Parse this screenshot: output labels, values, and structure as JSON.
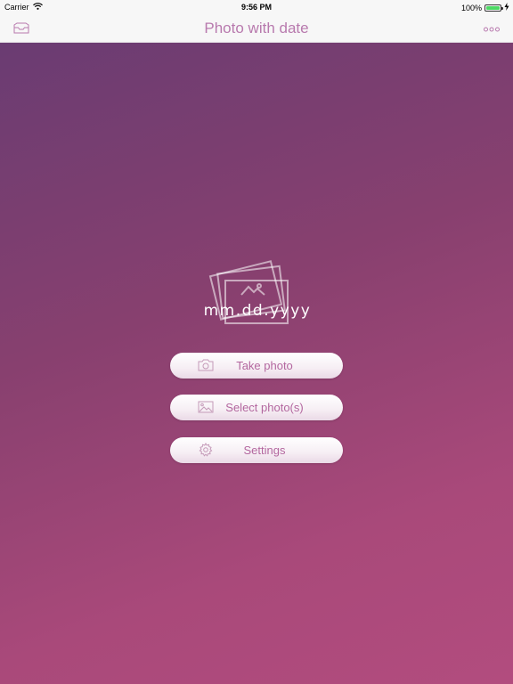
{
  "status_bar": {
    "carrier": "Carrier",
    "time": "9:56 PM",
    "battery": "100%",
    "battery_level": 1.0,
    "icons": [
      "wifi-icon",
      "charging-icon",
      "battery-icon"
    ]
  },
  "nav": {
    "title": "Photo with date",
    "left_icon": "inbox-icon",
    "right_icon": "more-icon"
  },
  "logo": {
    "date_format": "mm.dd.yyyy",
    "icon": "photo-stack-icon"
  },
  "buttons": [
    {
      "label": "Take photo",
      "icon": "camera-icon"
    },
    {
      "label": "Select photo(s)",
      "icon": "image-icon"
    },
    {
      "label": "Settings",
      "icon": "gear-icon"
    }
  ],
  "colors": {
    "accent": "#b87aae",
    "gradient_top": "#6a3c72",
    "gradient_bottom": "#b24c7e",
    "button_text": "#b3679f",
    "battery_green": "#4cd964"
  }
}
